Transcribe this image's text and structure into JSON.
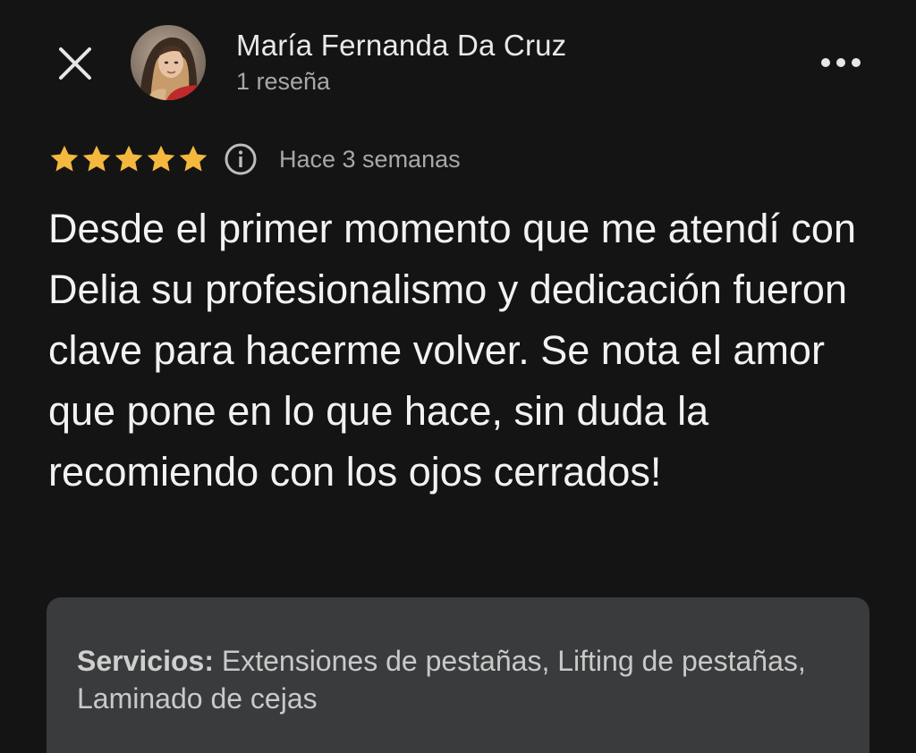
{
  "header": {
    "close_icon": "close-icon",
    "author_name": "María Fernanda Da Cruz",
    "author_meta": "1 reseña",
    "more_icon": "more-horizontal-icon"
  },
  "review": {
    "rating": 5,
    "rating_max": 5,
    "star_color": "#f4b83f",
    "date": "Hace 3 semanas",
    "text": "Desde el primer momento que me atendí con Delia su profesionalismo y dedicación fueron clave para hacerme volver. Se nota el amor que pone en lo que hace, sin duda la recomiendo con los ojos cerrados!"
  },
  "services": {
    "label": "Servicios:",
    "value": "Extensiones de pestañas, Lifting de pestañas, Laminado de cejas"
  },
  "colors": {
    "background": "#141414",
    "card": "#3a3b3d",
    "primary_text": "#f2f2f2",
    "secondary_text": "#a8a8a8"
  }
}
